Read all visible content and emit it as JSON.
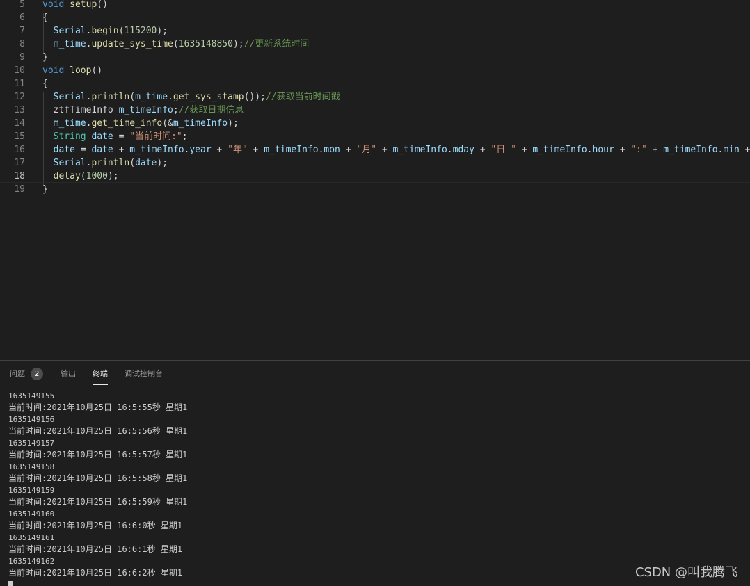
{
  "editor": {
    "lines": [
      {
        "n": "5",
        "tokens": [
          [
            "kw",
            "void"
          ],
          [
            "pl",
            " "
          ],
          [
            "fn",
            "setup"
          ],
          [
            "pl",
            "()"
          ]
        ]
      },
      {
        "n": "6",
        "tokens": [
          [
            "pl",
            "{"
          ]
        ]
      },
      {
        "n": "7",
        "tokens": [
          [
            "pl",
            "  "
          ],
          [
            "var",
            "Serial"
          ],
          [
            "pl",
            "."
          ],
          [
            "fn",
            "begin"
          ],
          [
            "pl",
            "("
          ],
          [
            "num",
            "115200"
          ],
          [
            "pl",
            ");"
          ]
        ]
      },
      {
        "n": "8",
        "tokens": [
          [
            "pl",
            "  "
          ],
          [
            "var",
            "m_time"
          ],
          [
            "pl",
            "."
          ],
          [
            "fn",
            "update_sys_time"
          ],
          [
            "pl",
            "("
          ],
          [
            "num",
            "1635148850"
          ],
          [
            "pl",
            ");"
          ],
          [
            "cm",
            "//更新系统时间"
          ]
        ]
      },
      {
        "n": "9",
        "tokens": [
          [
            "pl",
            "}"
          ]
        ]
      },
      {
        "n": "10",
        "tokens": [
          [
            "kw",
            "void"
          ],
          [
            "pl",
            " "
          ],
          [
            "fn",
            "loop"
          ],
          [
            "pl",
            "()"
          ]
        ]
      },
      {
        "n": "11",
        "tokens": [
          [
            "pl",
            "{"
          ]
        ]
      },
      {
        "n": "12",
        "tokens": [
          [
            "pl",
            "  "
          ],
          [
            "var",
            "Serial"
          ],
          [
            "pl",
            "."
          ],
          [
            "fn",
            "println"
          ],
          [
            "pl",
            "("
          ],
          [
            "var",
            "m_time"
          ],
          [
            "pl",
            "."
          ],
          [
            "fn",
            "get_sys_stamp"
          ],
          [
            "pl",
            "());"
          ],
          [
            "cm",
            "//获取当前时间戳"
          ]
        ]
      },
      {
        "n": "13",
        "tokens": [
          [
            "pl",
            "  "
          ],
          [
            "pl",
            "ztfTimeInfo"
          ],
          [
            "pl",
            " "
          ],
          [
            "var",
            "m_timeInfo"
          ],
          [
            "pl",
            ";"
          ],
          [
            "cm",
            "//获取日期信息"
          ]
        ]
      },
      {
        "n": "14",
        "tokens": [
          [
            "pl",
            "  "
          ],
          [
            "var",
            "m_time"
          ],
          [
            "pl",
            "."
          ],
          [
            "fn",
            "get_time_info"
          ],
          [
            "pl",
            "(&"
          ],
          [
            "var",
            "m_timeInfo"
          ],
          [
            "pl",
            ");"
          ]
        ]
      },
      {
        "n": "15",
        "tokens": [
          [
            "pl",
            "  "
          ],
          [
            "ty",
            "String"
          ],
          [
            "pl",
            " "
          ],
          [
            "var",
            "date"
          ],
          [
            "pl",
            " = "
          ],
          [
            "str",
            "\"当前时间:\""
          ],
          [
            "pl",
            ";"
          ]
        ]
      },
      {
        "n": "16",
        "tokens": [
          [
            "pl",
            "  "
          ],
          [
            "var",
            "date"
          ],
          [
            "pl",
            " = "
          ],
          [
            "var",
            "date"
          ],
          [
            "pl",
            " + "
          ],
          [
            "var",
            "m_timeInfo"
          ],
          [
            "pl",
            "."
          ],
          [
            "var",
            "year"
          ],
          [
            "pl",
            " + "
          ],
          [
            "str",
            "\"年\""
          ],
          [
            "pl",
            " + "
          ],
          [
            "var",
            "m_timeInfo"
          ],
          [
            "pl",
            "."
          ],
          [
            "var",
            "mon"
          ],
          [
            "pl",
            " + "
          ],
          [
            "str",
            "\"月\""
          ],
          [
            "pl",
            " + "
          ],
          [
            "var",
            "m_timeInfo"
          ],
          [
            "pl",
            "."
          ],
          [
            "var",
            "mday"
          ],
          [
            "pl",
            " + "
          ],
          [
            "str",
            "\"日 \""
          ],
          [
            "pl",
            " + "
          ],
          [
            "var",
            "m_timeInfo"
          ],
          [
            "pl",
            "."
          ],
          [
            "var",
            "hour"
          ],
          [
            "pl",
            " + "
          ],
          [
            "str",
            "\":\""
          ],
          [
            "pl",
            " + "
          ],
          [
            "var",
            "m_timeInfo"
          ],
          [
            "pl",
            "."
          ],
          [
            "var",
            "min"
          ],
          [
            "pl",
            " + "
          ],
          [
            "str",
            "\""
          ]
        ]
      },
      {
        "n": "17",
        "tokens": [
          [
            "pl",
            "  "
          ],
          [
            "var",
            "Serial"
          ],
          [
            "pl",
            "."
          ],
          [
            "fn",
            "println"
          ],
          [
            "pl",
            "("
          ],
          [
            "var",
            "date"
          ],
          [
            "pl",
            ");"
          ]
        ]
      },
      {
        "n": "18",
        "current": true,
        "tokens": [
          [
            "pl",
            "  "
          ],
          [
            "fn",
            "delay"
          ],
          [
            "pl",
            "("
          ],
          [
            "num",
            "1000"
          ],
          [
            "pl",
            ");"
          ]
        ]
      },
      {
        "n": "19",
        "tokens": [
          [
            "pl",
            "}"
          ]
        ]
      }
    ]
  },
  "panel": {
    "tabs": {
      "problems": "问题",
      "problems_count": "2",
      "output": "输出",
      "terminal": "终端",
      "debug_console": "调试控制台"
    },
    "terminal_lines": [
      {
        "text": "1635149155",
        "stamp": true
      },
      {
        "text": "当前时间:2021年10月25日 16:5:55秒 星期1"
      },
      {
        "text": "1635149156",
        "stamp": true
      },
      {
        "text": "当前时间:2021年10月25日 16:5:56秒 星期1"
      },
      {
        "text": "1635149157",
        "stamp": true
      },
      {
        "text": "当前时间:2021年10月25日 16:5:57秒 星期1"
      },
      {
        "text": "1635149158",
        "stamp": true
      },
      {
        "text": "当前时间:2021年10月25日 16:5:58秒 星期1"
      },
      {
        "text": "1635149159",
        "stamp": true
      },
      {
        "text": "当前时间:2021年10月25日 16:5:59秒 星期1"
      },
      {
        "text": "1635149160",
        "stamp": true
      },
      {
        "text": "当前时间:2021年10月25日 16:6:0秒 星期1"
      },
      {
        "text": "1635149161",
        "stamp": true
      },
      {
        "text": "当前时间:2021年10月25日 16:6:1秒 星期1"
      },
      {
        "text": "1635149162",
        "stamp": true
      },
      {
        "text": "当前时间:2021年10月25日 16:6:2秒 星期1"
      }
    ]
  },
  "watermark": "CSDN @叫我腾飞"
}
